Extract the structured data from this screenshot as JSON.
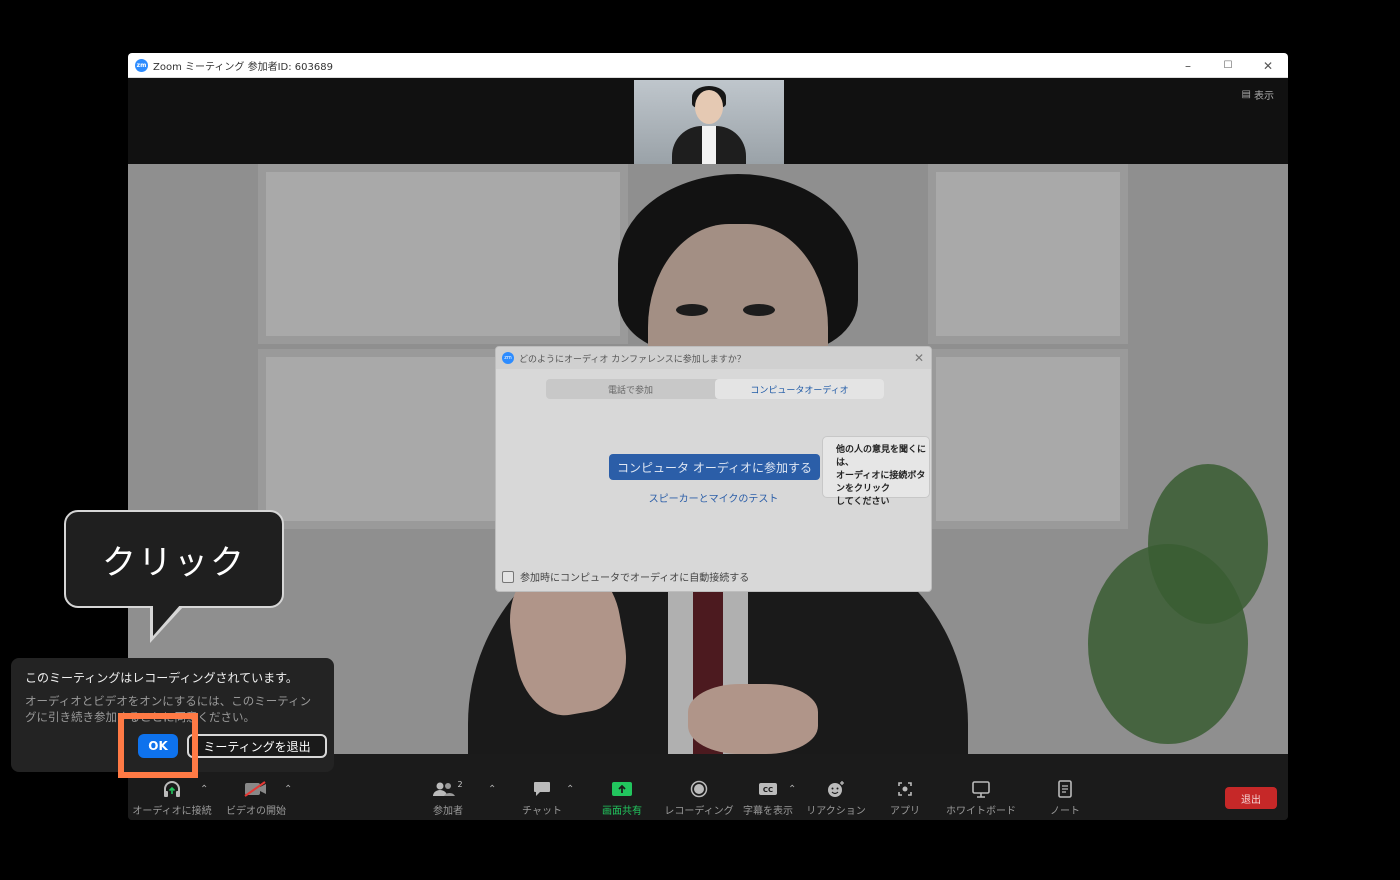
{
  "window": {
    "title": "Zoom ミーティング 参加者ID: 603689",
    "logo": "zm",
    "controls": {
      "minimize": "–",
      "maximize": "☐",
      "close": "✕"
    }
  },
  "top_bar": {
    "view_label": "表示"
  },
  "audio_dialog": {
    "title": "どのようにオーディオ カンファレンスに参加しますか？",
    "tabs": [
      "電話で参加",
      "コンピュータオーディオ"
    ],
    "active_tab": 1,
    "join_button": "コンピュータ オーディオに参加する",
    "test_link": "スピーカーとマイクのテスト",
    "auto_connect_label": "参加時にコンピュータでオーディオに自動接続する"
  },
  "hint": {
    "line1": "他の人の意見を聞くには、",
    "line2": "オーディオに接続ボタンをクリック",
    "line3": "してください"
  },
  "toolbar": {
    "audio": "オーディオに接続",
    "video": "ビデオの開始",
    "participants": "参加者",
    "participants_count": "2",
    "chat": "チャット",
    "share": "画面共有",
    "record": "レコーディング",
    "captions": "字幕を表示",
    "reactions": "リアクション",
    "apps": "アプリ",
    "whiteboard": "ホワイトボード",
    "notes": "ノート",
    "leave": "退出",
    "share_color": "#22c55e",
    "leave_color": "#c62828"
  },
  "callout": {
    "text": "クリック"
  },
  "recording_popup": {
    "title": "このミーティングはレコーディングされています。",
    "body": "オーディオとビデオをオンにするには、このミーティングに引き続き参加することに同意ください。",
    "ok": "OK",
    "leave": "ミーティングを退出",
    "ok_color": "#0e72ed"
  },
  "highlight_color": "#ff7a45"
}
